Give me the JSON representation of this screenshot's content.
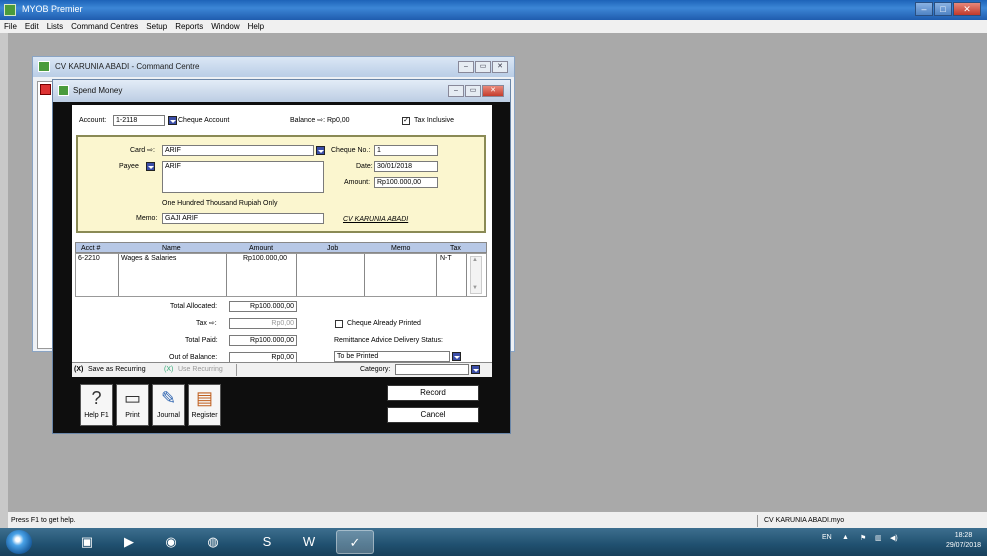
{
  "app": {
    "title": "MYOB Premier"
  },
  "menu": [
    "File",
    "Edit",
    "Lists",
    "Command Centres",
    "Setup",
    "Reports",
    "Window",
    "Help"
  ],
  "command_centre": {
    "title": "CV KARUNIA ABADI - Command Centre"
  },
  "spend_money": {
    "title": "Spend Money",
    "account_label": "Account:",
    "account_number": "1-2118",
    "account_name": "Cheque Account",
    "balance": "Balance ⇨: Rp0,00",
    "tax_inclusive_label": "Tax Inclusive",
    "tax_inclusive_checked": true,
    "card_label": "Card ⇨:",
    "card_value": "ARIF",
    "payee_label": "Payee",
    "payee_value": "ARIF",
    "cheque_no_label": "Cheque No.:",
    "cheque_no": "1",
    "date_label": "Date:",
    "date": "30/01/2018",
    "amount_label": "Amount:",
    "amount": "Rp100.000,00",
    "amount_words": "One Hundred Thousand Rupiah  Only",
    "memo_label": "Memo:",
    "memo": "GAJI ARIF",
    "company_signature": "CV KARUNIA ABADI",
    "grid": {
      "headers": [
        "Acct #",
        "Name",
        "Amount",
        "Job",
        "Memo",
        "Tax"
      ],
      "rows": [
        {
          "acct": "6-2210",
          "name": "Wages & Salaries",
          "amount": "Rp100.000,00",
          "job": "",
          "memo": "",
          "tax": "N-T"
        }
      ]
    },
    "totals": {
      "total_allocated_label": "Total Allocated:",
      "total_allocated": "Rp100.000,00",
      "tax_label": "Tax ⇨:",
      "tax": "Rp0,00",
      "total_paid_label": "Total Paid:",
      "total_paid": "Rp100.000,00",
      "out_of_balance_label": "Out of Balance:",
      "out_of_balance": "Rp0,00"
    },
    "cheque_printed_label": "Cheque Already Printed",
    "remittance_label": "Remittance Advice Delivery Status:",
    "remittance_value": "To be Printed",
    "save_recurring": "Save as Recurring",
    "use_recurring": "Use Recurring",
    "category_label": "Category:",
    "category_value": "",
    "buttons": {
      "help": "Help F1",
      "print": "Print",
      "journal": "Journal",
      "register": "Register",
      "record": "Record",
      "cancel": "Cancel"
    }
  },
  "statusbar": {
    "left": "Press F1 to get help.",
    "right": "CV KARUNIA ABADI.myo"
  },
  "taskbar": {
    "lang": "EN",
    "time": "18:28",
    "date": "29/07/2018"
  }
}
